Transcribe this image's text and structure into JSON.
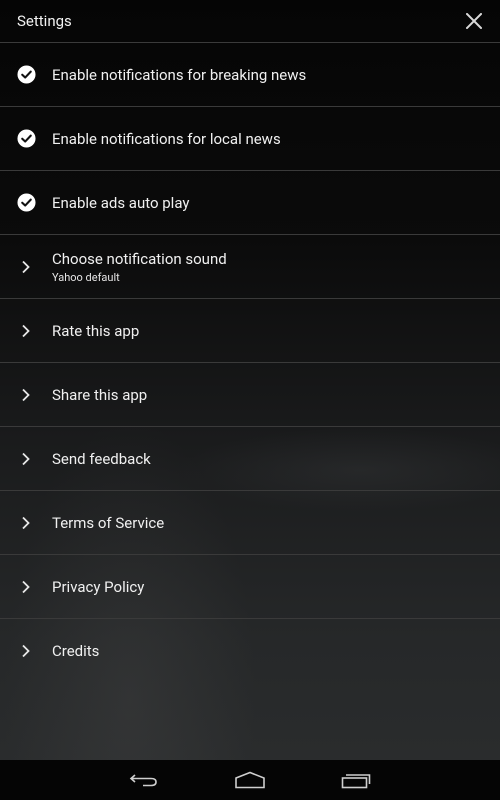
{
  "header": {
    "title": "Settings",
    "close_icon": "close-icon"
  },
  "items": [
    {
      "type": "checkbox",
      "checked": true,
      "label": "Enable notifications for breaking news"
    },
    {
      "type": "checkbox",
      "checked": true,
      "label": "Enable notifications for local news"
    },
    {
      "type": "checkbox",
      "checked": true,
      "label": "Enable ads auto play"
    },
    {
      "type": "link",
      "label": "Choose notification sound",
      "sublabel": "Yahoo default"
    },
    {
      "type": "link",
      "label": "Rate this app"
    },
    {
      "type": "link",
      "label": "Share this app"
    },
    {
      "type": "link",
      "label": "Send feedback"
    },
    {
      "type": "link",
      "label": "Terms of Service"
    },
    {
      "type": "link",
      "label": "Privacy Policy"
    },
    {
      "type": "link",
      "label": "Credits"
    }
  ],
  "navbar": {
    "buttons": [
      "back-icon",
      "home-icon",
      "recent-apps-icon"
    ]
  }
}
